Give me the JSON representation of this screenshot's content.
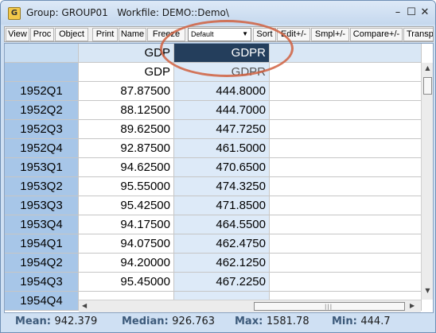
{
  "window": {
    "title": "Group: GROUP01   Workfile: DEMO::Demo\\",
    "app_icon_letter": "G"
  },
  "titlebar_buttons": {
    "minimize": "–",
    "maximize": "☐",
    "close": "✕"
  },
  "toolbar": {
    "buttons": [
      "View",
      "Proc",
      "Object",
      "Print",
      "Name",
      "Freeze"
    ],
    "dropdown_value": "Default",
    "buttons2": [
      "Sort",
      "Edit+/-",
      "Smpl+/-",
      "Compare+/-",
      "Transp"
    ]
  },
  "grid": {
    "headers": [
      "",
      "GDP",
      "GDPR",
      ""
    ],
    "subheaders": [
      "",
      "GDP",
      "GDPR",
      ""
    ],
    "rows": [
      [
        "1952Q1",
        "87.87500",
        "444.8000"
      ],
      [
        "1952Q2",
        "88.12500",
        "444.7000"
      ],
      [
        "1952Q3",
        "89.62500",
        "447.7250"
      ],
      [
        "1952Q4",
        "92.87500",
        "461.5000"
      ],
      [
        "1953Q1",
        "94.62500",
        "470.6500"
      ],
      [
        "1953Q2",
        "95.55000",
        "474.3250"
      ],
      [
        "1953Q3",
        "95.42500",
        "471.8500"
      ],
      [
        "1953Q4",
        "94.17500",
        "464.5500"
      ],
      [
        "1954Q1",
        "94.07500",
        "462.4750"
      ],
      [
        "1954Q2",
        "94.20000",
        "462.1250"
      ],
      [
        "1954Q3",
        "95.45000",
        "467.2250"
      ],
      [
        "1954Q4",
        "",
        ""
      ]
    ]
  },
  "status": {
    "mean_label": "Mean:",
    "mean_value": "942.379",
    "median_label": "Median:",
    "median_value": "926.763",
    "max_label": "Max:",
    "max_value": "1581.78",
    "min_label": "Min:",
    "min_value": "444.7"
  },
  "colors": {
    "selected_header": "#243e5c",
    "highlight_oval": "#d06040",
    "row_label": "#a7c6e8"
  }
}
